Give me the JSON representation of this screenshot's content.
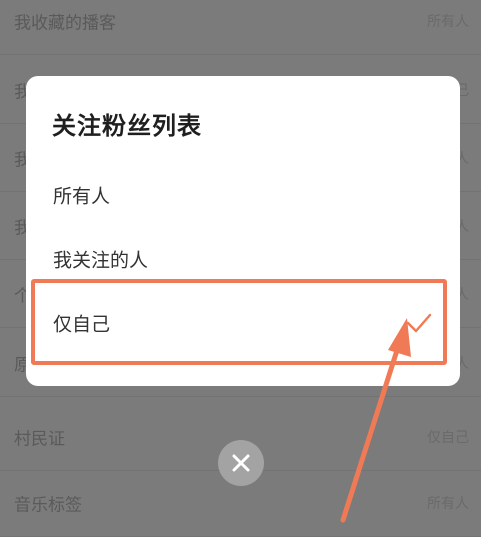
{
  "background_list": [
    {
      "label": "我收藏的播客",
      "value": "所有人"
    },
    {
      "label": "我",
      "value": "己"
    },
    {
      "label": "我",
      "value": "人"
    },
    {
      "label": "我",
      "value": "人"
    },
    {
      "label": "个",
      "value": "人"
    },
    {
      "label": "原",
      "value": "人"
    },
    {
      "label": "村民证",
      "value": "仅自己"
    },
    {
      "label": "音乐标签",
      "value": "所有人"
    }
  ],
  "dialog": {
    "title": "关注粉丝列表",
    "options": [
      {
        "label": "所有人",
        "selected": false
      },
      {
        "label": "我关注的人",
        "selected": false
      },
      {
        "label": "仅自己",
        "selected": true
      }
    ]
  },
  "colors": {
    "accent": "#f07a55",
    "check": "#f07a55",
    "overlay": "#7b7b7b"
  },
  "icons": {
    "check": "check-icon",
    "close": "close-icon",
    "annotation": "annotation-arrow"
  }
}
